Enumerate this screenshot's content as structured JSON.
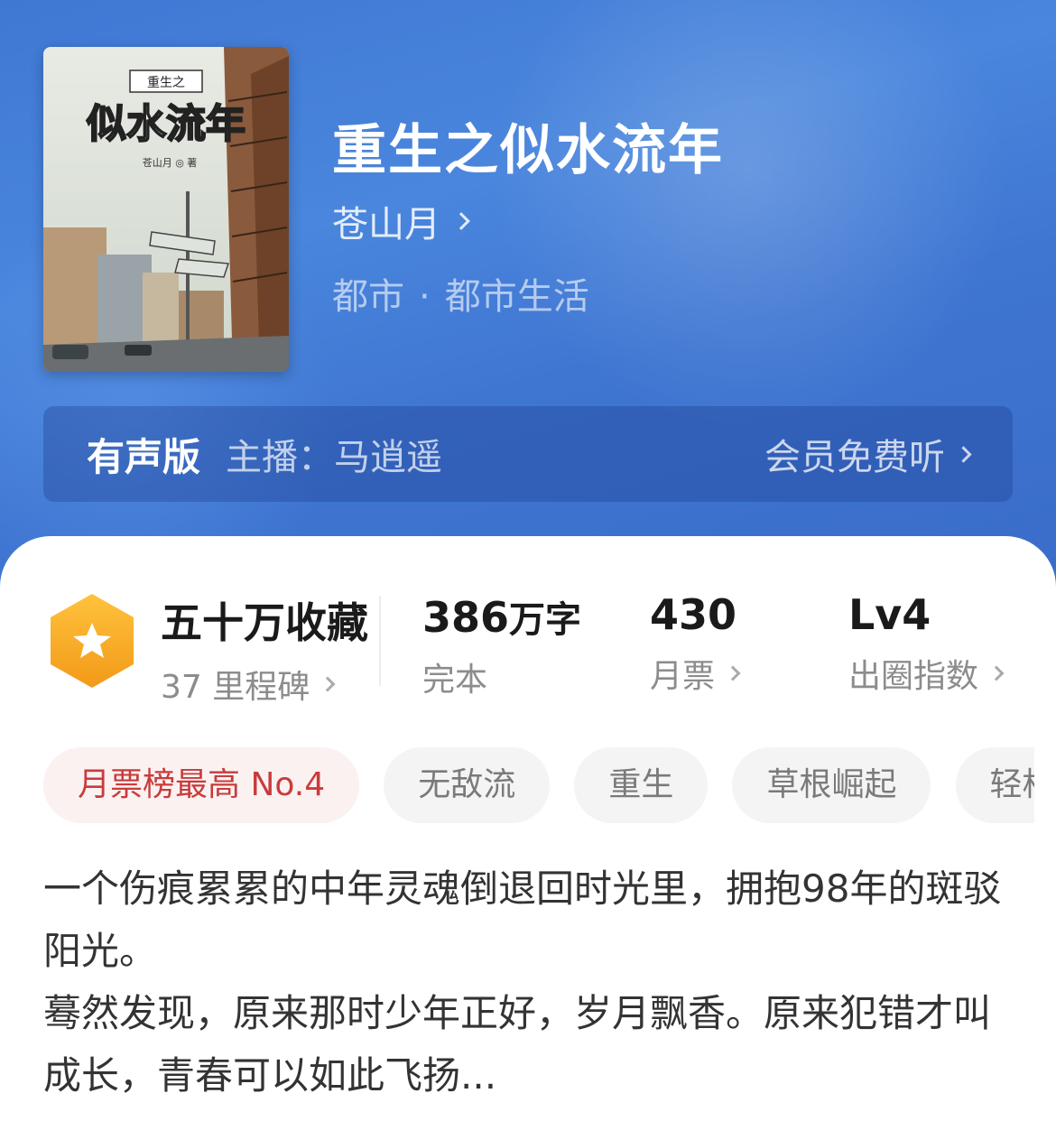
{
  "book": {
    "title": "重生之似水流年",
    "author": "苍山月",
    "genre_main": "都市",
    "genre_separator": "·",
    "genre_sub": "都市生活",
    "cover": {
      "series_label": "重生之",
      "title_text": "似水流年",
      "author_text": "苍山月 ◎ 著"
    }
  },
  "audio": {
    "label": "有声版",
    "host": "主播：马逍遥",
    "free_listen": "会员免费听"
  },
  "stats": {
    "collections": {
      "value": "五十万收藏",
      "sub": "37 里程碑"
    },
    "words": {
      "number": "386",
      "unit": "万字",
      "sub": "完本"
    },
    "monthly_tickets": {
      "value": "430",
      "sub": "月票"
    },
    "influence": {
      "value": "Lv4",
      "sub": "出圈指数"
    }
  },
  "tags": [
    "月票榜最高 No.4",
    "无敌流",
    "重生",
    "草根崛起",
    "轻松"
  ],
  "description": [
    "一个伤痕累累的中年灵魂倒退回时光里，拥抱98年的斑驳阳光。",
    "蓦然发现，原来那时少年正好，岁月飘香。原来犯错才叫成长，青春可以如此飞扬..."
  ],
  "colors": {
    "hero_blue": "#4a86dd",
    "badge_orange": "#f5a623",
    "hot_tag_red": "#c93b3b"
  }
}
